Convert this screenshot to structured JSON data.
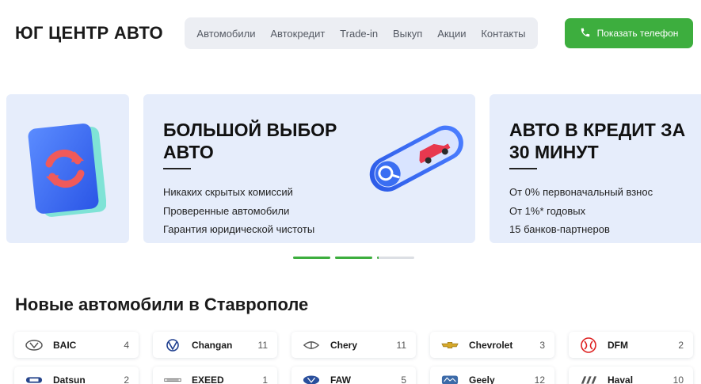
{
  "header": {
    "logo": "ЮГ ЦЕНТР АВТО",
    "nav": [
      "Автомобили",
      "Автокредит",
      "Trade-in",
      "Выкуп",
      "Акции",
      "Контакты"
    ],
    "phone_button": "Показать телефон"
  },
  "slides": [
    {
      "title_line1": "БОЛЬШОЙ ВЫБОР",
      "title_line2": "АВТО",
      "items": [
        "Никаких скрытых комиссий",
        "Проверенные автомобили",
        "Гарантия юридической чистоты"
      ]
    },
    {
      "title_line1": "АВТО В КРЕДИТ ЗА",
      "title_line2": "30 МИНУТ",
      "items": [
        "От 0% первоначальный взнос",
        "От 1%* годовых",
        "15 банков-партнеров"
      ]
    }
  ],
  "slider_progress": [
    1.0,
    1.0,
    0.05
  ],
  "section_title": "Новые автомобили в Ставрополе",
  "brands": [
    {
      "name": "BAIC",
      "count": "4",
      "icon": "baic-logo-icon"
    },
    {
      "name": "Changan",
      "count": "11",
      "icon": "changan-logo-icon"
    },
    {
      "name": "Chery",
      "count": "11",
      "icon": "chery-logo-icon"
    },
    {
      "name": "Chevrolet",
      "count": "3",
      "icon": "chevrolet-logo-icon"
    },
    {
      "name": "DFM",
      "count": "2",
      "icon": "dfm-logo-icon"
    },
    {
      "name": "Datsun",
      "count": "2",
      "icon": "datsun-logo-icon"
    },
    {
      "name": "EXEED",
      "count": "1",
      "icon": "exeed-logo-icon"
    },
    {
      "name": "FAW",
      "count": "5",
      "icon": "faw-logo-icon"
    },
    {
      "name": "Geely",
      "count": "12",
      "icon": "geely-logo-icon"
    },
    {
      "name": "Haval",
      "count": "10",
      "icon": "haval-logo-icon"
    }
  ],
  "colors": {
    "accent": "#3dae3e",
    "slide_bg": "#e6edfb",
    "nav_bg": "#eceef3"
  }
}
